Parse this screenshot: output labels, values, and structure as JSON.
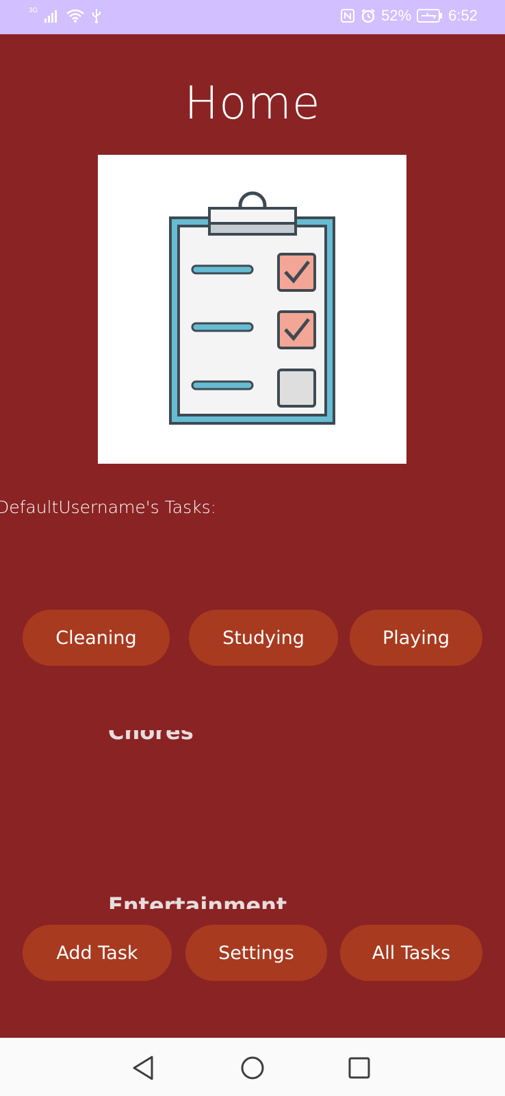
{
  "status_bar": {
    "network_type": "3G",
    "battery_percent": "52%",
    "time": "6:52"
  },
  "header": {
    "title": "Home"
  },
  "hero": {
    "icon": "clipboard-checklist-icon"
  },
  "tasks": {
    "heading": "DefaultUsername's Tasks:"
  },
  "categories": {
    "cleaning_label": "Cleaning",
    "studying_label": "Studying",
    "playing_label": "Playing"
  },
  "groups": {
    "chores": "Chores",
    "entertainment": "Entertainment"
  },
  "actions": {
    "add_task_label": "Add Task",
    "settings_label": "Settings",
    "all_tasks_label": "All Tasks"
  },
  "colors": {
    "background": "#8a2324",
    "button": "#a83a1f",
    "status_bar": "#d2bfff"
  }
}
